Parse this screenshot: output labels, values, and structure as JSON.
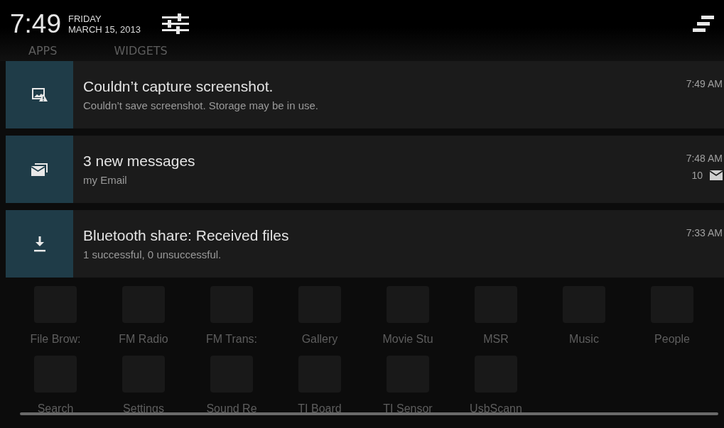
{
  "status_header": {
    "time": "7:49",
    "day": "FRIDAY",
    "date": "MARCH 15, 2013"
  },
  "background_tabs": [
    "APPS",
    "WIDGETS"
  ],
  "notifications": [
    {
      "kind": "screenshot",
      "title": "Couldn’t capture screenshot.",
      "text": "Couldn’t save screenshot. Storage may be in use.",
      "time": "7:49 AM"
    },
    {
      "kind": "email",
      "title": "3 new messages",
      "text": "my Email",
      "time": "7:48 AM",
      "count": "10"
    },
    {
      "kind": "download",
      "title": "Bluetooth share: Received files",
      "text": "1 successful, 0 unsuccessful.",
      "time": "7:33 AM"
    }
  ],
  "app_drawer": {
    "rows": [
      [
        "File Brow:",
        "FM Radio",
        "FM Trans:",
        "Gallery",
        "Movie Stu",
        "MSR",
        "Music",
        "People"
      ],
      [
        "Search",
        "Settings",
        "Sound Re",
        "TI Board",
        "TI Sensor",
        "UsbScann"
      ]
    ]
  }
}
